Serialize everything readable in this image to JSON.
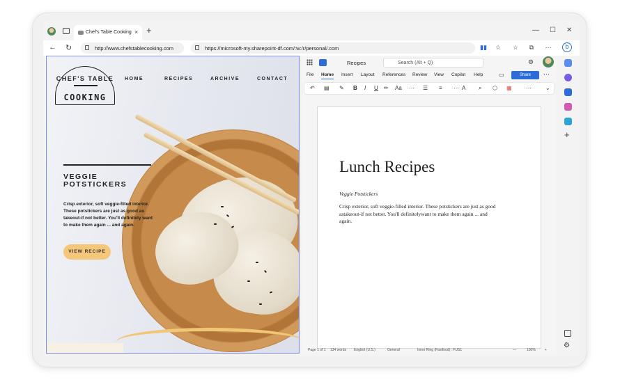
{
  "browser": {
    "tab_title": "Chef's Table Cooking",
    "left_url": "http://www.chefstablecooking.com",
    "right_url": "https://microsoft-my.sharepoint-df.com/:w:/r/personal/.com"
  },
  "website": {
    "logo_line1": "CHEF'S TABLE",
    "logo_line2": "COOKING",
    "nav": [
      "HOME",
      "RECIPES",
      "ARCHIVE",
      "CONTACT"
    ],
    "headline": "VEGGIE POTSTICKERS",
    "description": "Crisp exterior, soft veggie-filled interior. These potstickers are just as good as takeout-if not better. You'll definitely want to make them again ... and again.",
    "cta": "VIEW RECIPE"
  },
  "word": {
    "doc_name": "Recipes",
    "search_placeholder": "Search (Alt + Q)",
    "menu": [
      "File",
      "Home",
      "Insert",
      "Layout",
      "References",
      "Review",
      "View",
      "Copilot",
      "Help"
    ],
    "share": "Share",
    "ribbon": {
      "bold": "B",
      "italic": "I",
      "underline": "U",
      "font_size": "Aa"
    },
    "title": "Lunch Recipes",
    "subtitle": "Veggie Potstickers",
    "body": "Crisp exterior, soft veggie-filled interior. These potstickers are just as good astakeout-if not better. You'll definitelywant to make them again ... and again.",
    "status": {
      "page": "Page 1 of 1",
      "words": "134 words",
      "lang": "English (U.S.)",
      "sensitivity": "General",
      "ring": "Inner Ring (Fastfood) : FUS1",
      "zoom": "100%"
    }
  }
}
